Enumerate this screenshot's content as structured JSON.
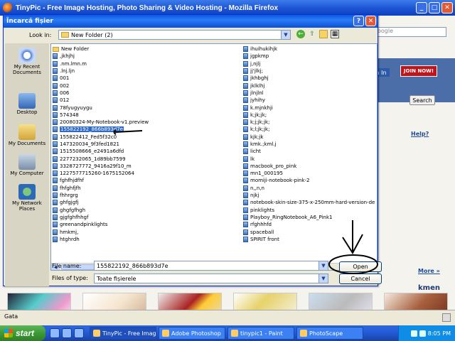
{
  "firefox": {
    "title": "TinyPic - Free Image Hosting, Photo Sharing & Video Hosting - Mozilla Firefox",
    "minimize": "_",
    "restore": "□",
    "close": "✕"
  },
  "page": {
    "search_placeholder": "oogle",
    "sign_in": "n In",
    "join_now": "JOIN NOW!",
    "search_button": "Search",
    "help": "Help?",
    "more": "More »",
    "section_label": "kmen",
    "status_text": "Gata"
  },
  "dialog": {
    "title": "Încarcă fișier",
    "help_btn": "?",
    "close_btn": "✕",
    "look_in_label": "Look in:",
    "look_in_value": "New Folder (2)",
    "places": [
      {
        "label": "My Recent Documents"
      },
      {
        "label": "Desktop"
      },
      {
        "label": "My Documents"
      },
      {
        "label": "My Computer"
      },
      {
        "label": "My Network Places"
      }
    ],
    "files_col1": [
      "New Folder",
      ",jkhjhj",
      ".nm.lmn.m",
      ".lnj.ljn",
      "001",
      "002",
      "006",
      "012",
      "78fyugyuygu",
      "574348",
      "20080324-My-Notebook-v1.preview",
      "155822192_866b893d7e",
      "155822412_Fed5f32c0",
      "147320034_9f3fed1821",
      "1515508666_e2491a6dfd",
      "2277232065_1d89bb7599",
      "3328727772_9416a29f10_m",
      "1227577715260-1675152064",
      "fghfhjdfhf",
      "fhfghfjfh",
      "fhhrgrg",
      "ghfgjgfj",
      "ghgfgfhgh",
      "gjgfghfhhgf",
      "greenandpinklights",
      "hmkmj,",
      "htghrdh"
    ],
    "files_col2": [
      "ihuihukihjk",
      "jgpkmp",
      "j,njlj",
      "jj'jlkj;",
      "jkhbghj",
      "jklklhj",
      "jlnjlnl",
      "jyhihy",
      "k.mjnkhji",
      "k;jk;jk;",
      "k;j;jk;jk;",
      "k;l;jk;jk;",
      "kjk;jk",
      "kmk.;kml.j",
      "licht",
      "lk",
      "macbook_pro_pink",
      "mn1_000195",
      "momiji-notebook-pink-2",
      "n,,n,n",
      "njkj",
      "notebook-skin-size-375-x-250mm-hard-version-de",
      "pinklights",
      "Playboy_RingNotebook_A6_Pink1",
      "rfghhhfd",
      "spaceball",
      "SPIRIT front"
    ],
    "selected_file": "155822192_866b893d7e",
    "file_name_label": "File name:",
    "file_name_value": "155822192_866b893d7e",
    "file_type_label": "Files of type:",
    "file_type_value": "Toate fișierele",
    "open_btn": "Open",
    "cancel_btn": "Cancel"
  },
  "taskbar": {
    "start": "start",
    "tasks": [
      "TinyPic - Free Image ...",
      "Adobe Photoshop",
      "tinypic1 - Paint",
      "PhotoScape"
    ],
    "clock": "8:05 PM"
  }
}
